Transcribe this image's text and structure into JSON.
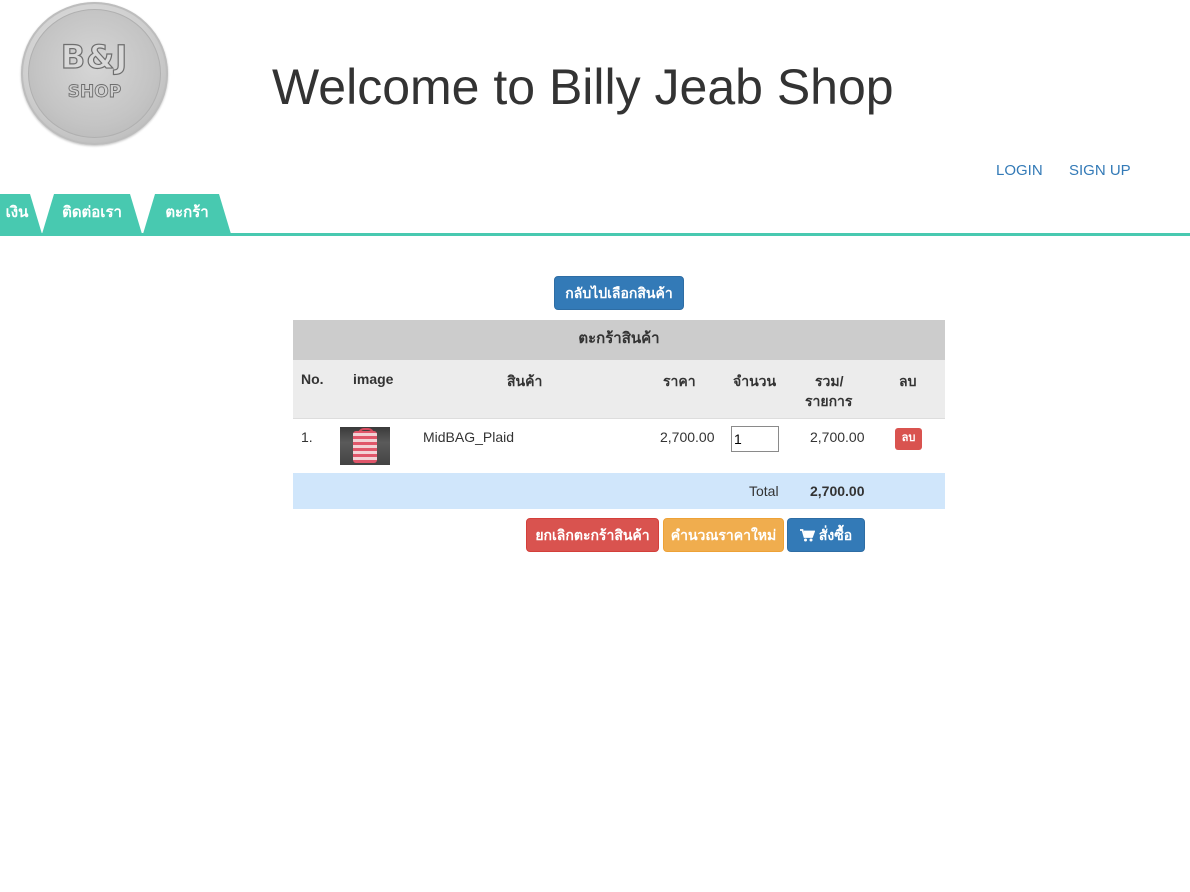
{
  "header": {
    "logo_text_top": "B&J",
    "logo_text_bottom": "SHOP",
    "title": "Welcome to Billy Jeab Shop"
  },
  "auth": {
    "login": "LOGIN",
    "signup": "SIGN UP"
  },
  "tabs": [
    {
      "label": "เงิน"
    },
    {
      "label": "ติดต่อเรา"
    },
    {
      "label": "ตะกร้า"
    }
  ],
  "back_button": "กลับไปเลือกสินค้า",
  "cart": {
    "heading": "ตะกร้าสินค้า",
    "columns": {
      "no": "No.",
      "image": "image",
      "product": "สินค้า",
      "price": "ราคา",
      "quantity": "จำนวน",
      "subtotal_line1": "รวม/",
      "subtotal_line2": "รายการ",
      "delete": "ลบ"
    },
    "items": [
      {
        "no": "1.",
        "name": "MidBAG_Plaid",
        "price": "2,700.00",
        "quantity": "1",
        "subtotal": "2,700.00",
        "delete_label": "ลบ"
      }
    ],
    "total_label": "Total",
    "total_value": "2,700.00"
  },
  "actions": {
    "cancel": "ยกเลิกตะกร้าสินค้า",
    "recalculate": "คำนวณราคาใหม่",
    "order": "สั่งซื้อ"
  },
  "colors": {
    "tab": "#48c9b0",
    "primary": "#337ab7",
    "danger": "#d9534f",
    "warning": "#f0ad4e",
    "total_row": "#d0e6fb"
  }
}
